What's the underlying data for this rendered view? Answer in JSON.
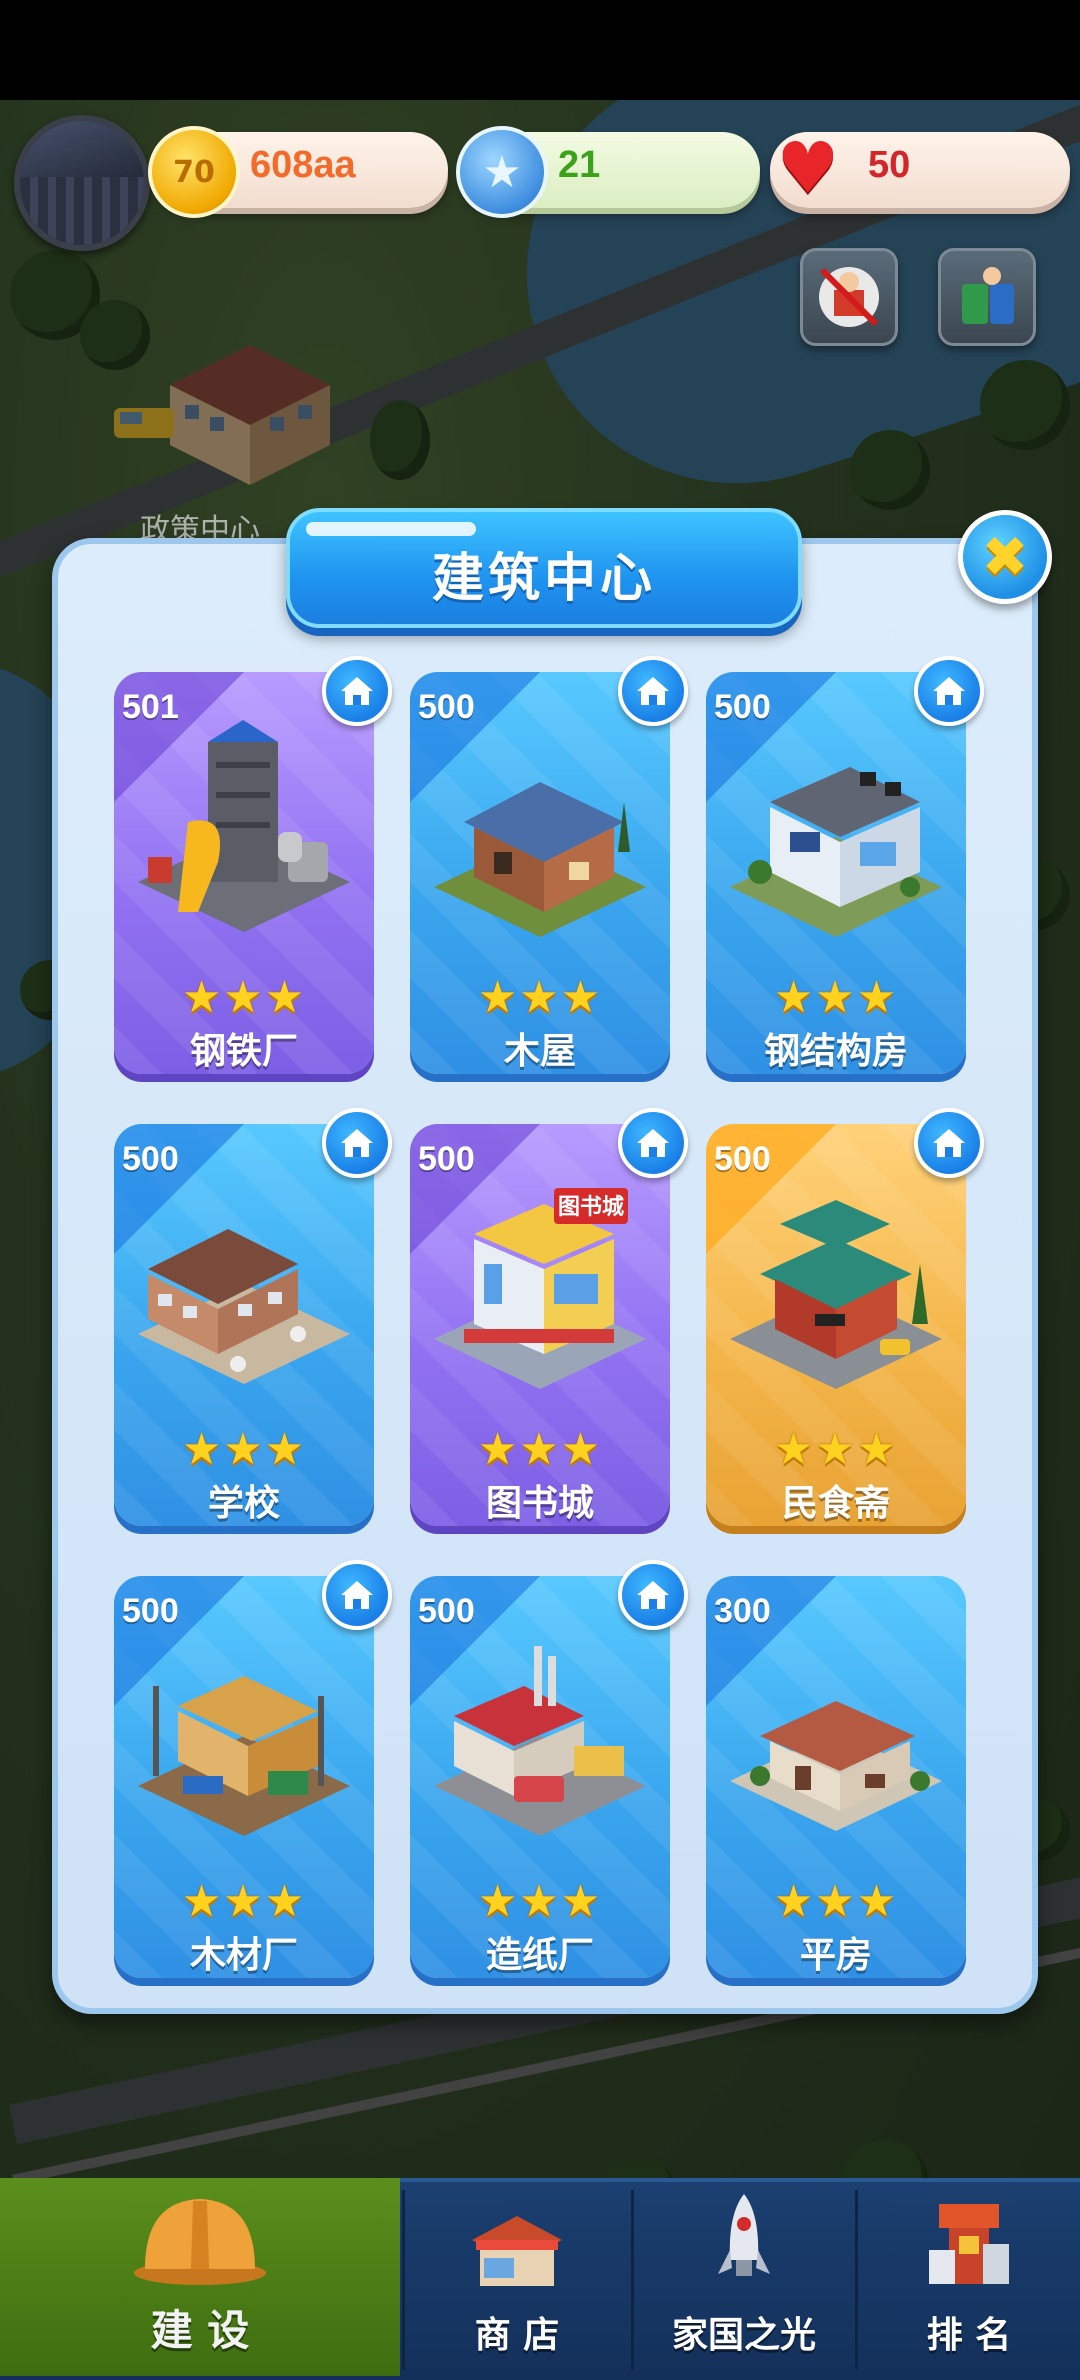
{
  "map": {
    "label": "政策中心"
  },
  "hud": {
    "coins": "608aa",
    "coin_symbol": "70",
    "stars": "21",
    "hearts": "50"
  },
  "dialog": {
    "title": "建筑中心",
    "close_symbol": "✖",
    "cards": [
      {
        "level": "501",
        "stars": "★★★",
        "name": "钢铁厂",
        "theme": "purple",
        "home_badge": true
      },
      {
        "level": "500",
        "stars": "★★★",
        "name": "木屋",
        "theme": "blue",
        "home_badge": true
      },
      {
        "level": "500",
        "stars": "★★★",
        "name": "钢结构房",
        "theme": "blue",
        "home_badge": true
      },
      {
        "level": "500",
        "stars": "★★★",
        "name": "学校",
        "theme": "blue",
        "home_badge": true
      },
      {
        "level": "500",
        "stars": "★★★",
        "name": "图书城",
        "theme": "purple",
        "home_badge": true
      },
      {
        "level": "500",
        "stars": "★★★",
        "name": "民食斋",
        "theme": "gold",
        "home_badge": true
      },
      {
        "level": "500",
        "stars": "★★★",
        "name": "木材厂",
        "theme": "blue",
        "home_badge": true
      },
      {
        "level": "500",
        "stars": "★★★",
        "name": "造纸厂",
        "theme": "blue",
        "home_badge": true
      },
      {
        "level": "300",
        "stars": "★★★",
        "name": "平房",
        "theme": "blue",
        "home_badge": false
      }
    ],
    "sign_text": "图书城"
  },
  "nav": {
    "items": [
      {
        "label": "建 设",
        "icon": "hard-hat-icon",
        "active": true
      },
      {
        "label": "商 店",
        "icon": "shop-icon",
        "active": false
      },
      {
        "label": "家国之光",
        "icon": "rocket-icon",
        "active": false
      },
      {
        "label": "排 名",
        "icon": "ranking-icon",
        "active": false
      }
    ]
  },
  "colors": {
    "accent_blue": "#2f90e4",
    "purple": "#9272f2",
    "gold": "#f4b64a",
    "nav_active": "#5b8f1c"
  }
}
